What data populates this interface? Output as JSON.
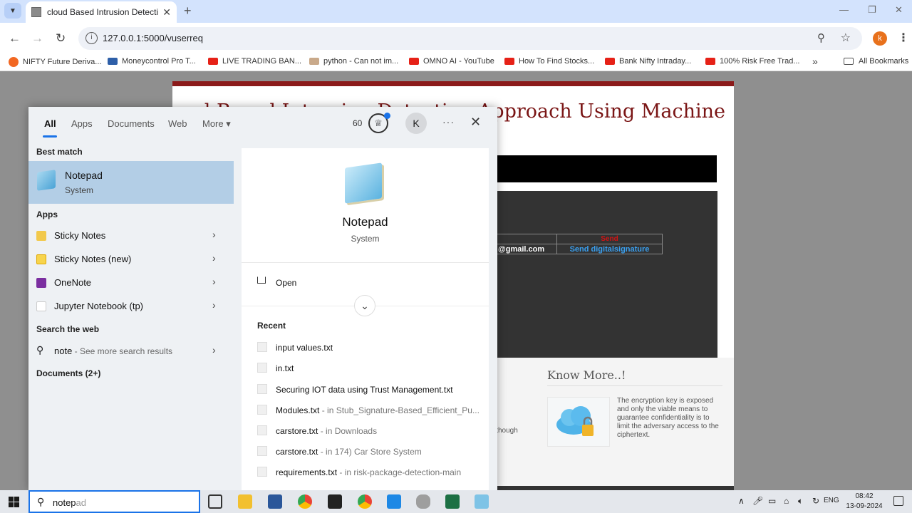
{
  "browser": {
    "tab_title": "cloud Based Intrusion Detection",
    "url": "127.0.0.1:5000/vuserreq",
    "profile_initial": "k",
    "bookmarks": [
      {
        "label": "NIFTY Future Deriva...",
        "icon": "nifty-icon"
      },
      {
        "label": "Moneycontrol Pro T...",
        "icon": "moneycontrol-icon"
      },
      {
        "label": "LIVE TRADING BAN...",
        "icon": "youtube-icon"
      },
      {
        "label": "python - Can not im...",
        "icon": "stackoverflow-icon"
      },
      {
        "label": "OMNO AI - YouTube",
        "icon": "youtube-icon"
      },
      {
        "label": "How To Find Stocks...",
        "icon": "youtube-icon"
      },
      {
        "label": "Bank Nifty Intraday...",
        "icon": "youtube-icon"
      },
      {
        "label": "100% Risk Free Trad...",
        "icon": "youtube-icon"
      }
    ],
    "all_bookmarks": "All Bookmarks"
  },
  "site": {
    "title_fragment": "oud Based Intrusion Detection Approach Using Machine",
    "table_email": "@gmail.com",
    "table_send": "Send",
    "table_signature": "Send digitalsignature",
    "know_more": "Know More..!",
    "know_text": "The encryption key is exposed and only the viable means to guarantee confidentiality is to limit the adversary access to the ciphertext.",
    "left_fragment": "lthough"
  },
  "start_menu": {
    "tabs": [
      "All",
      "Apps",
      "Documents",
      "Web",
      "More"
    ],
    "points": "60",
    "account_initial": "K",
    "best_match_heading": "Best match",
    "best_match": {
      "name": "Notepad",
      "type": "System"
    },
    "apps_heading": "Apps",
    "apps": [
      {
        "label": "Sticky Notes"
      },
      {
        "label": "Sticky Notes (new)"
      },
      {
        "label": "OneNote"
      },
      {
        "label": "Jupyter Notebook (tp)"
      }
    ],
    "search_web_heading": "Search the web",
    "search_web_query": "note",
    "search_web_suffix": " - See more search results",
    "documents_heading": "Documents (2+)",
    "preview": {
      "name": "Notepad",
      "type": "System",
      "open_label": "Open",
      "recent_heading": "Recent",
      "recent": [
        {
          "name": "input values.txt",
          "loc": ""
        },
        {
          "name": "in.txt",
          "loc": ""
        },
        {
          "name": "Securing IOT data using Trust Management.txt",
          "loc": ""
        },
        {
          "name": "Modules.txt",
          "loc": " - in Stub_Signature-Based_Efficient_Pu..."
        },
        {
          "name": "carstore.txt",
          "loc": " - in Downloads"
        },
        {
          "name": "carstore.txt",
          "loc": " - in 174) Car Store System"
        },
        {
          "name": "requirements.txt",
          "loc": " - in risk-package-detection-main"
        }
      ]
    }
  },
  "taskbar": {
    "search_typed": "notep",
    "search_ghost": "ad",
    "lang": "ENG",
    "time": "08:42",
    "date": "13-09-2024"
  }
}
